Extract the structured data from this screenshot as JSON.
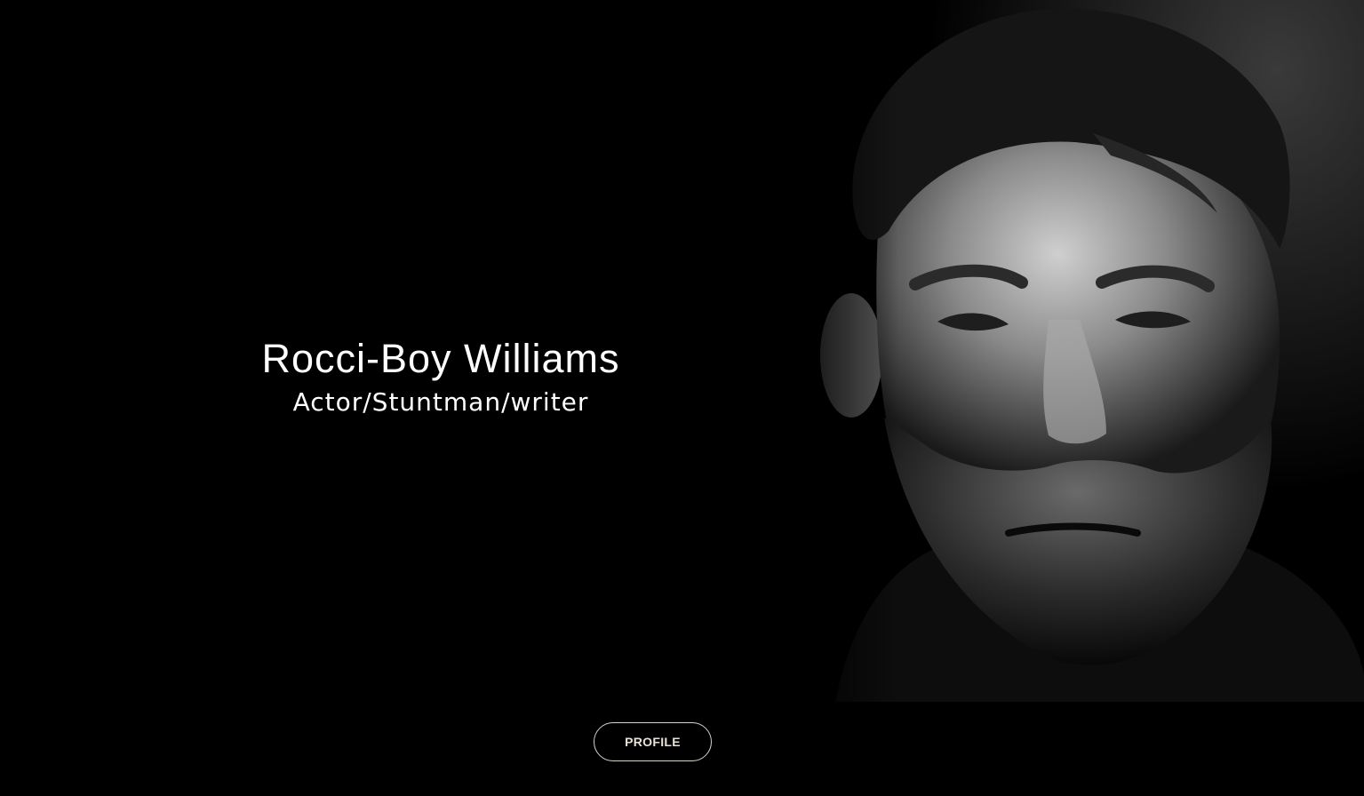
{
  "hero": {
    "name": "Rocci-Boy Williams",
    "tagline": "Actor/Stuntman/writer",
    "photo_subject": "black-and-white portrait of a bearded man"
  },
  "profile_button": {
    "label": "PROFILE"
  },
  "colors": {
    "background": "#000000",
    "text": "#ffffff",
    "button_border": "#d8d4cc",
    "button_text": "#e8e2d6"
  }
}
